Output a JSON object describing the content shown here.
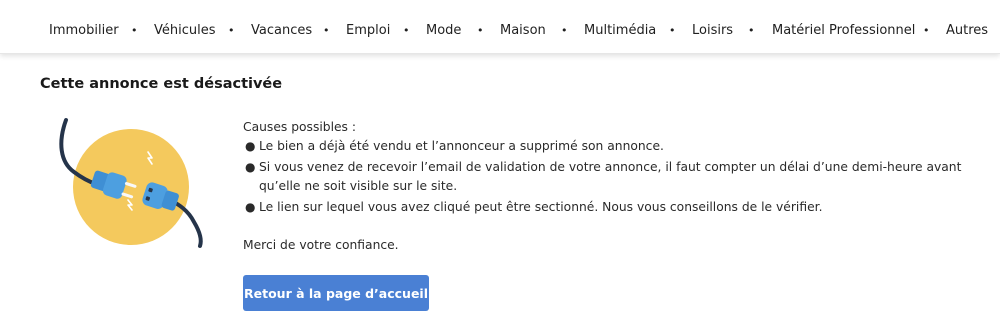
{
  "nav": {
    "items": [
      {
        "label": "Immobilier"
      },
      {
        "label": "Véhicules"
      },
      {
        "label": "Vacances"
      },
      {
        "label": "Emploi"
      },
      {
        "label": "Mode"
      },
      {
        "label": "Maison"
      },
      {
        "label": "Multimédia"
      },
      {
        "label": "Loisirs"
      },
      {
        "label": "Matériel Professionnel"
      },
      {
        "label": "Autres"
      }
    ],
    "separator": "•"
  },
  "page": {
    "title": "Cette annonce est désactivée",
    "causes_title": "Causes possibles :",
    "causes": [
      "Le bien a déjà été vendu et l’annonceur a supprimé son annonce.",
      "Si vous venez de recevoir l’email de validation de votre annonce, il faut compter un délai d’une demi-heure avant qu’elle ne soit visible sur le site.",
      "Le lien sur lequel vous avez cliqué peut être sectionné. Nous vous conseillons de le vérifier."
    ],
    "thanks": "Merci de votre confiance.",
    "home_button": "Retour à la page d’accueil"
  },
  "colors": {
    "accent": "#4a80d4",
    "illustration_circle": "#f4c95d",
    "plug_blue": "#4d9fe0",
    "cable": "#25344a"
  },
  "icons": {
    "illustration": "unplugged-cable-icon"
  }
}
